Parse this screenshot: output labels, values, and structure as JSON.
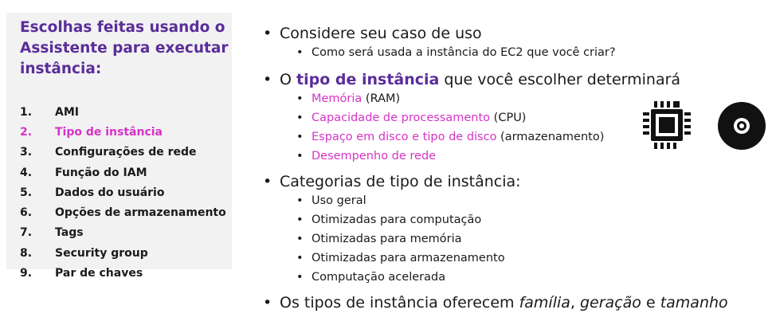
{
  "panel": {
    "title": "Escolhas feitas usando o Assistente para executar instância:",
    "steps": [
      {
        "num": "1.",
        "label": "AMI"
      },
      {
        "num": "2.",
        "label": "Tipo de instância"
      },
      {
        "num": "3.",
        "label": "Configurações de rede"
      },
      {
        "num": "4.",
        "label": "Função do IAM"
      },
      {
        "num": "5.",
        "label": "Dados do usuário"
      },
      {
        "num": "6.",
        "label": "Opções de armazenamento"
      },
      {
        "num": "7.",
        "label": "Tags"
      },
      {
        "num": "8.",
        "label": "Security group"
      },
      {
        "num": "9.",
        "label": "Par de chaves"
      }
    ]
  },
  "content": {
    "b1": "Considere seu caso de uso",
    "b1_sub": "Como será usada a instância do EC2 que você criar?",
    "b2_pre": "O ",
    "b2_hl": "tipo de instância",
    "b2_post": " que você escolher determinará",
    "b2_subs": [
      {
        "hl": "Memória",
        "rest": " (RAM)"
      },
      {
        "hl": "Capacidade de processamento",
        "rest": " (CPU)"
      },
      {
        "hl": "Espaço em disco e tipo de disco",
        "rest": " (armazenamento)"
      },
      {
        "hl": "Desempenho de rede",
        "rest": ""
      }
    ],
    "b3": "Categorias de tipo de instância:",
    "b3_subs": [
      "Uso geral",
      "Otimizadas para computação",
      "Otimizadas para memória",
      "Otimizadas para armazenamento",
      "Computação acelerada"
    ],
    "b4_a": "Os tipos de instância oferecem ",
    "b4_i1": "família",
    "b4_b": ", ",
    "b4_i2": "geração",
    "b4_c": " e ",
    "b4_i3": "tamanho"
  },
  "icons": [
    "cpu-chip-icon",
    "disk-icon"
  ]
}
